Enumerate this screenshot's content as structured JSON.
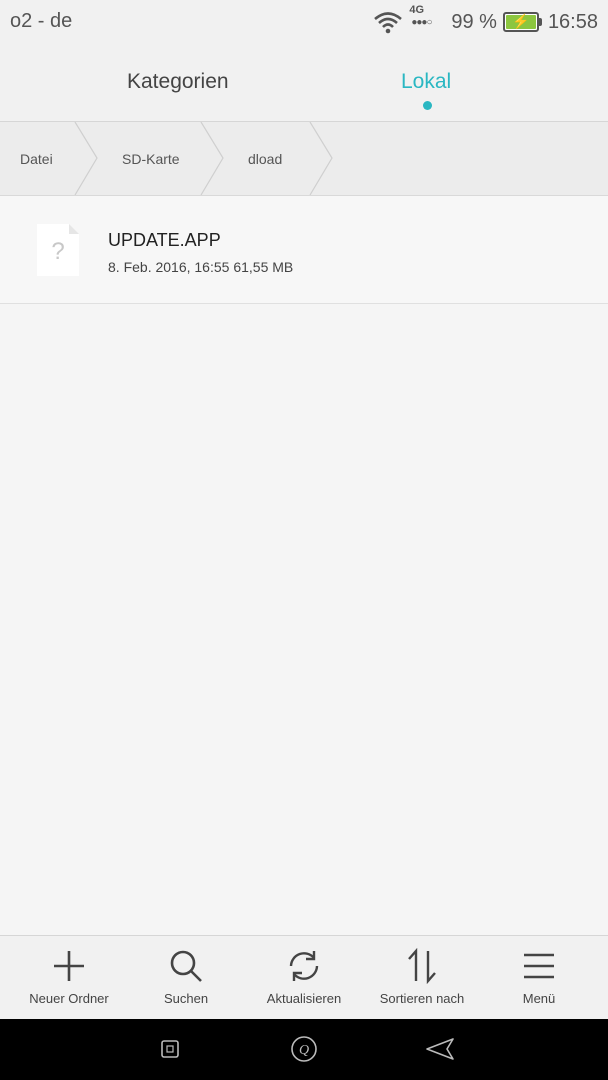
{
  "status": {
    "carrier": "o2 - de",
    "network": "4G",
    "battery": "99 %",
    "time": "16:58"
  },
  "tabs": [
    {
      "label": "Kategorien",
      "active": false
    },
    {
      "label": "Lokal",
      "active": true
    }
  ],
  "breadcrumb": [
    "Datei",
    "SD-Karte",
    "dload"
  ],
  "files": [
    {
      "name": "UPDATE.APP",
      "meta": "8. Feb. 2016, 16:55 61,55 MB",
      "icon": "unknown-file-icon"
    }
  ],
  "toolbar": {
    "new_folder": "Neuer Ordner",
    "search": "Suchen",
    "refresh": "Aktualisieren",
    "sort": "Sortieren nach",
    "menu": "Menü"
  },
  "colors": {
    "accent": "#2ab7c2",
    "battery": "#8cc63f"
  }
}
